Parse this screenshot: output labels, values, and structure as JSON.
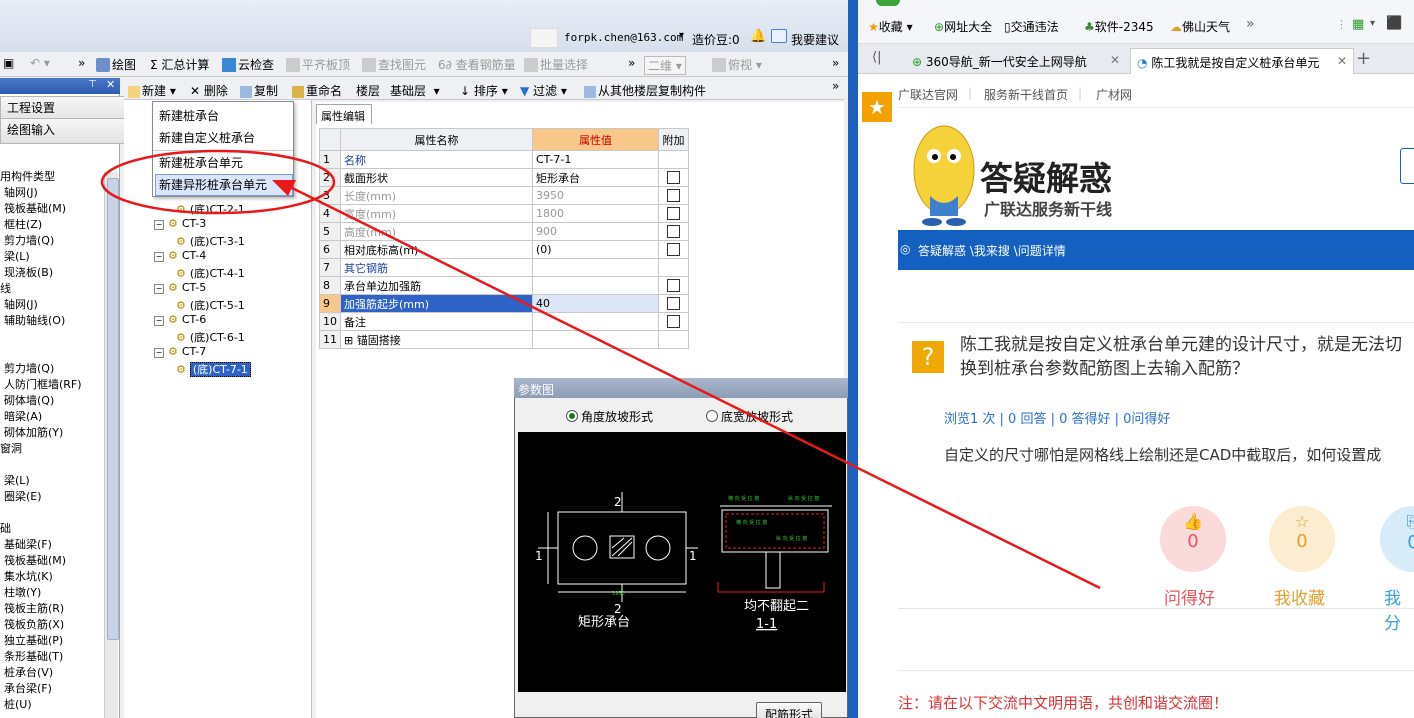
{
  "left_app": {
    "account": "forpk.chen@163.com",
    "cost_beans": "造价豆:0",
    "suggest": "我要建议",
    "toolbar": {
      "draw": "绘图",
      "sum": "汇总计算",
      "cloud_check": "云检查",
      "flat_slab": "平齐板顶",
      "find_element": "查找图元",
      "view_rebar": "查看钢筋量",
      "batch_select": "批量选择",
      "view_mode": "二维",
      "view_angle": "俯视"
    },
    "nav": {
      "project_settings": "工程设置",
      "drawing_input": "绘图输入",
      "items": [
        "用构件类型",
        "轴网(J)",
        "筏板基础(M)",
        "框柱(Z)",
        "剪力墙(Q)",
        "梁(L)",
        "现浇板(B)",
        "线",
        "轴网(J)",
        "辅助轴线(O)",
        "剪力墙(Q)",
        "人防门框墙(RF)",
        "砌体墙(Q)",
        "暗梁(A)",
        "砌体加筋(Y)",
        "窗洞",
        "梁(L)",
        "圈梁(E)",
        "础",
        "基础梁(F)",
        "筏板基础(M)",
        "集水坑(K)",
        "柱墩(Y)",
        "筏板主筋(R)",
        "筏板负筋(X)",
        "独立基础(P)",
        "条形基础(T)",
        "桩承台(V)",
        "承台梁(F)",
        "桩(U)"
      ]
    },
    "tree_toolbar": {
      "new": "新建",
      "delete": "删除",
      "copy": "复制",
      "rename": "重命名",
      "floor_label": "楼层",
      "floor_value": "基础层",
      "sort": "排序",
      "filter": "过滤",
      "copy_from_floor": "从其他楼层复制构件"
    },
    "new_menu": [
      "新建桩承台",
      "新建自定义桩承台",
      "新建桩承台单元",
      "新建异形桩承台单元"
    ],
    "tree": [
      {
        "label": "(底)CT-2-1",
        "type": "child"
      },
      {
        "label": "CT-3",
        "type": "parent"
      },
      {
        "label": "(底)CT-3-1",
        "type": "child"
      },
      {
        "label": "CT-4",
        "type": "parent"
      },
      {
        "label": "(底)CT-4-1",
        "type": "child"
      },
      {
        "label": "CT-5",
        "type": "parent"
      },
      {
        "label": "(底)CT-5-1",
        "type": "child"
      },
      {
        "label": "CT-6",
        "type": "parent"
      },
      {
        "label": "(底)CT-6-1",
        "type": "child"
      },
      {
        "label": "CT-7",
        "type": "parent"
      },
      {
        "label": "(底)CT-7-1",
        "type": "child"
      }
    ],
    "props": {
      "tab": "属性编辑",
      "headers": [
        "属性名称",
        "属性值",
        "附加"
      ],
      "rows": [
        {
          "n": "1",
          "name": "名称",
          "value": "CT-7-1",
          "check": false,
          "style": "blue"
        },
        {
          "n": "2",
          "name": "截面形状",
          "value": "矩形承台",
          "check": true,
          "style": ""
        },
        {
          "n": "3",
          "name": "长度(mm)",
          "value": "3950",
          "check": true,
          "style": "gray"
        },
        {
          "n": "4",
          "name": "宽度(mm)",
          "value": "1800",
          "check": true,
          "style": "gray"
        },
        {
          "n": "5",
          "name": "高度(mm)",
          "value": "900",
          "check": true,
          "style": "gray"
        },
        {
          "n": "6",
          "name": "相对底标高(m)",
          "value": "(0)",
          "check": true,
          "style": ""
        },
        {
          "n": "7",
          "name": "其它钢筋",
          "value": "",
          "check": false,
          "style": "blue"
        },
        {
          "n": "8",
          "name": "承台单边加强筋",
          "value": "",
          "check": true,
          "style": ""
        },
        {
          "n": "9",
          "name": "加强筋起步(mm)",
          "value": "40",
          "check": true,
          "style": "hi"
        },
        {
          "n": "10",
          "name": "备注",
          "value": "",
          "check": true,
          "style": ""
        },
        {
          "n": "11",
          "name": "锚固搭接",
          "value": "",
          "check": false,
          "style": "plus"
        }
      ]
    },
    "dialog": {
      "title": "参数图",
      "opt1": "角度放坡形式",
      "opt2": "底宽放坡形式",
      "cad_left_caption": "矩形承台",
      "cad_right_caption": "均不翻起二",
      "cad_section": "1-1",
      "btn": "配筋形式"
    }
  },
  "browser": {
    "favorites": "收藏",
    "bookmarks": [
      "网址大全",
      "交通违法",
      "软件-2345",
      "佛山天气"
    ],
    "tabs": [
      "360导航_新一代安全上网导航",
      "陈工我就是按自定义桩承台单元"
    ],
    "site_links": [
      "广联达官网",
      "服务新干线首页",
      "广材网"
    ],
    "logo_title": "答疑解惑",
    "logo_sub": "广联达服务新干线",
    "breadcrumb": "答疑解惑 \\我来搜 \\问题详情",
    "question": "陈工我就是按自定义桩承台单元建的设计尺寸，就是无法切换到桩承台参数配筋图上去输入配筋？",
    "stats": "浏览1 次 | 0 回答 | 0 答得好 | 0问得好",
    "body": "自定义的尺寸哪怕是网格线上绘制还是CAD中截取后，如何设置成",
    "actions": [
      {
        "count": "0",
        "label": "问得好",
        "color": "#e8555a"
      },
      {
        "count": "0",
        "label": "我收藏",
        "color": "#e2a030"
      },
      {
        "count": "0",
        "label": "我分",
        "color": "#3aa0e0"
      }
    ],
    "notice": "注：请在以下交流中文明用语，共创和谐交流圈！"
  },
  "colors": {
    "annotation_red": "#e8181b",
    "accent_blue": "#1460c0"
  }
}
